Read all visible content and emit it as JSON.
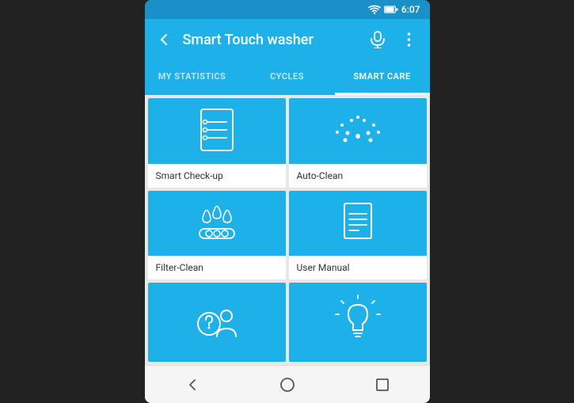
{
  "statusBar": {
    "time": "6:07",
    "wifiIcon": "wifi-icon",
    "batteryIcon": "battery-icon"
  },
  "toolbar": {
    "backLabel": "←",
    "title": "Smart Touch washer",
    "micIcon": "mic-icon",
    "moreIcon": "more-icon"
  },
  "tabs": [
    {
      "id": "my-statistics",
      "label": "MY STATISTICS",
      "active": false
    },
    {
      "id": "cycles",
      "label": "CYCLES",
      "active": false
    },
    {
      "id": "smart-care",
      "label": "SMART CARE",
      "active": true
    }
  ],
  "cards": [
    {
      "id": "smart-checkup",
      "label": "Smart Check-up",
      "icon": "checkup-icon"
    },
    {
      "id": "auto-clean",
      "label": "Auto-Clean",
      "icon": "autoclean-icon"
    },
    {
      "id": "filter-clean",
      "label": "Filter-Clean",
      "icon": "filterclean-icon"
    },
    {
      "id": "user-manual",
      "label": "User Manual",
      "icon": "usermanual-icon"
    },
    {
      "id": "help",
      "label": "",
      "icon": "help-icon"
    },
    {
      "id": "tips",
      "label": "",
      "icon": "tips-icon"
    }
  ],
  "navBar": {
    "backLabel": "◁",
    "homeLabel": "○",
    "recentLabel": "□"
  }
}
